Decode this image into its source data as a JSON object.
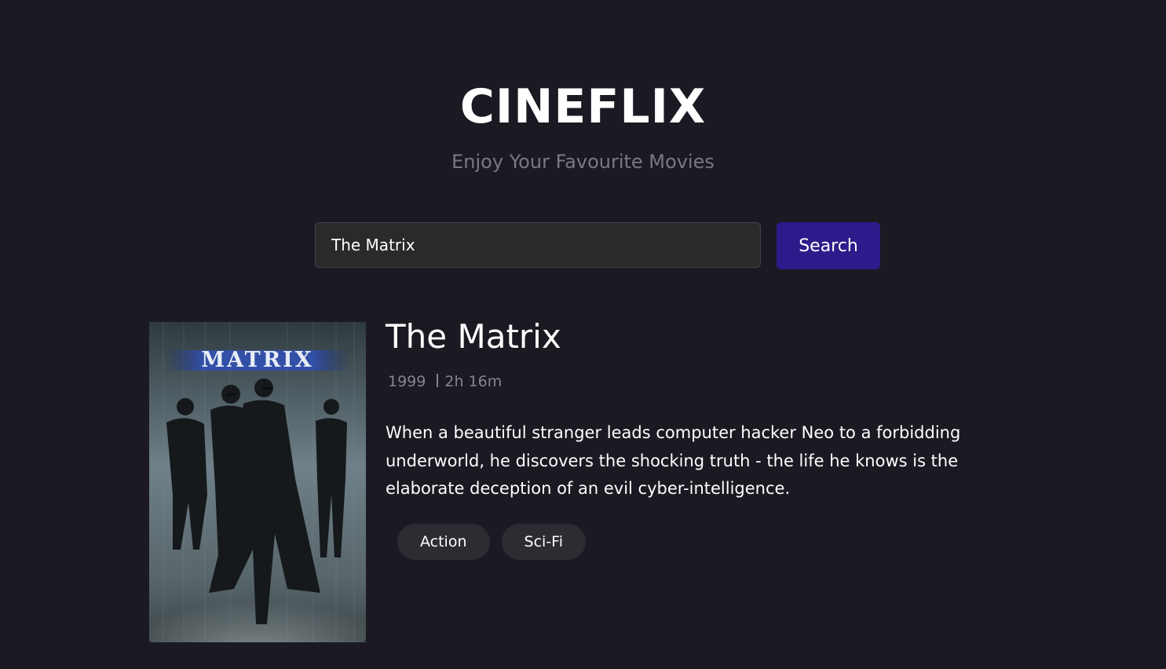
{
  "header": {
    "brand": "CINEFLIX",
    "tagline": "Enjoy Your Favourite Movies"
  },
  "search": {
    "value": "The Matrix",
    "button_label": "Search"
  },
  "movie": {
    "title": "The Matrix",
    "year": "1999",
    "runtime": "2h 16m",
    "plot": "When a beautiful stranger leads computer hacker Neo to a forbidding underworld, he discovers the shocking truth - the life he knows is the elaborate deception of an evil cyber-intelligence.",
    "genres": [
      "Action",
      "Sci-Fi"
    ],
    "poster": {
      "title_text": "MATRIX",
      "alt": "The Matrix poster"
    }
  },
  "colors": {
    "background": "#1b1a22",
    "accent": "#2e1a8a",
    "muted_text": "#7a7883",
    "pill": "#2d2c33"
  }
}
